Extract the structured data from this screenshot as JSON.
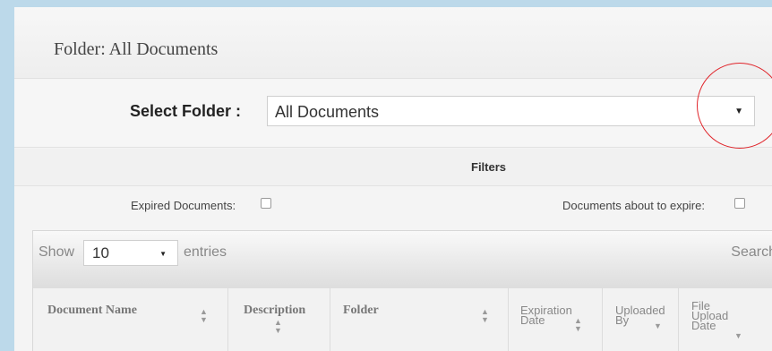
{
  "header": {
    "title": "Folder: All Documents"
  },
  "folder_select": {
    "label": "Select Folder :",
    "value": "All Documents"
  },
  "filters": {
    "title": "Filters",
    "expired_label": "Expired Documents:",
    "expired_checked": false,
    "about_to_expire_label": "Documents about to expire:",
    "about_to_expire_checked": false
  },
  "table": {
    "show_label": "Show",
    "page_size": "10",
    "entries_label": "entries",
    "search_label": "Search",
    "columns": [
      {
        "label": "Document Name",
        "sort_icon": "sort-both"
      },
      {
        "label": "Description",
        "sort_icon": "sort-both"
      },
      {
        "label": "Folder",
        "sort_icon": "sort-both"
      },
      {
        "label": "Expiration\nDate",
        "sort_icon": "sort-both"
      },
      {
        "label": "Uploaded\nBy",
        "sort_icon": "sort-desc"
      },
      {
        "label": "File\nUpload\nDate",
        "sort_icon": "sort-desc"
      }
    ]
  },
  "colors": {
    "background": "#bcd9ea",
    "highlight_circle": "#e0252b"
  }
}
